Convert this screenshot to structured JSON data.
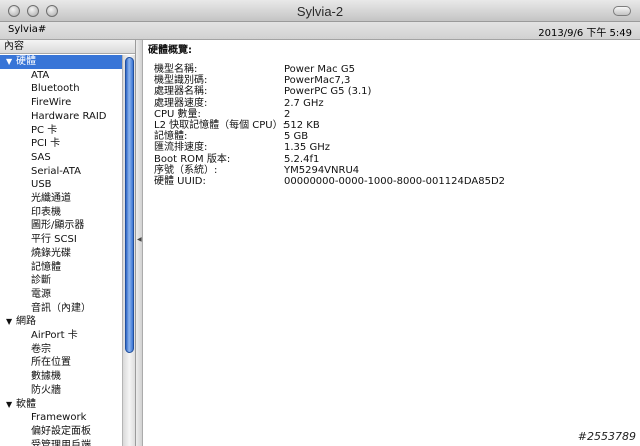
{
  "window": {
    "title": "Sylvia-2"
  },
  "pathbar": {
    "name": "Sylvia#",
    "datetime": "2013/9/6 下午 5:49"
  },
  "sidebar": {
    "header": "內容",
    "rows": [
      {
        "label": "硬體",
        "type": "sect",
        "expanded": true,
        "selected": true
      },
      {
        "label": "ATA",
        "type": "child"
      },
      {
        "label": "Bluetooth",
        "type": "child"
      },
      {
        "label": "FireWire",
        "type": "child"
      },
      {
        "label": "Hardware RAID",
        "type": "child"
      },
      {
        "label": "PC 卡",
        "type": "child"
      },
      {
        "label": "PCI 卡",
        "type": "child"
      },
      {
        "label": "SAS",
        "type": "child"
      },
      {
        "label": "Serial-ATA",
        "type": "child"
      },
      {
        "label": "USB",
        "type": "child"
      },
      {
        "label": "光纖通道",
        "type": "child"
      },
      {
        "label": "印表機",
        "type": "child"
      },
      {
        "label": "圖形/顯示器",
        "type": "child"
      },
      {
        "label": "平行 SCSI",
        "type": "child"
      },
      {
        "label": "燒錄光碟",
        "type": "child"
      },
      {
        "label": "記憶體",
        "type": "child"
      },
      {
        "label": "診斷",
        "type": "child"
      },
      {
        "label": "電源",
        "type": "child"
      },
      {
        "label": "音訊（內建）",
        "type": "child"
      },
      {
        "label": "網路",
        "type": "sect",
        "expanded": true
      },
      {
        "label": "AirPort 卡",
        "type": "child"
      },
      {
        "label": "卷宗",
        "type": "child"
      },
      {
        "label": "所在位置",
        "type": "child"
      },
      {
        "label": "數據機",
        "type": "child"
      },
      {
        "label": "防火牆",
        "type": "child"
      },
      {
        "label": "軟體",
        "type": "sect",
        "expanded": true
      },
      {
        "label": "Framework",
        "type": "child"
      },
      {
        "label": "偏好設定面板",
        "type": "child"
      },
      {
        "label": "受管理用戶端",
        "type": "child"
      }
    ]
  },
  "content": {
    "title": "硬體概覽:",
    "items": [
      {
        "key": "機型名稱:",
        "value": "Power Mac G5"
      },
      {
        "key": "機型識別碼:",
        "value": "PowerMac7,3"
      },
      {
        "key": "處理器名稱:",
        "value": "PowerPC G5  (3.1)"
      },
      {
        "key": "處理器速度:",
        "value": "2.7 GHz"
      },
      {
        "key": "CPU 數量:",
        "value": "2"
      },
      {
        "key": "L2 快取記憶體（每個 CPU）:",
        "value": "512 KB"
      },
      {
        "key": "記憶體:",
        "value": "5 GB"
      },
      {
        "key": "匯流排速度:",
        "value": "1.35 GHz"
      },
      {
        "key": "Boot ROM 版本:",
        "value": "5.2.4f1"
      },
      {
        "key": "序號（系統）:",
        "value": "YM5294VNRU4"
      },
      {
        "key": "硬體 UUID:",
        "value": "00000000-0000-1000-8000-001124DA85D2"
      }
    ]
  },
  "watermark": "#2553789",
  "colors": {
    "selection": "#3875d7",
    "scroll_thumb": "#3a74d4"
  }
}
